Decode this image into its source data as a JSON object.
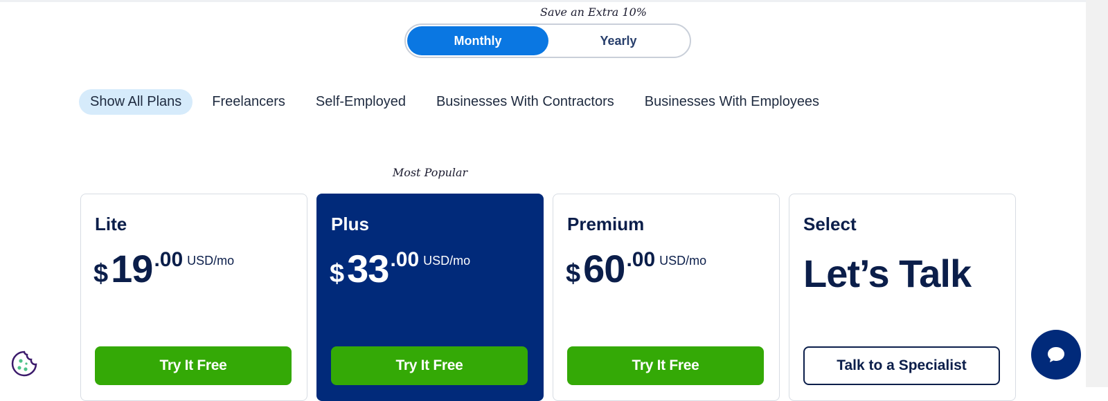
{
  "billing": {
    "save_note": "Save an Extra 10%",
    "options": [
      "Monthly",
      "Yearly"
    ],
    "selected": "Monthly"
  },
  "filters": {
    "items": [
      "Show All Plans",
      "Freelancers",
      "Self-Employed",
      "Businesses With Contractors",
      "Businesses With Employees"
    ],
    "active": "Show All Plans"
  },
  "badge": {
    "most_popular": "Most Popular"
  },
  "plans": [
    {
      "name": "Lite",
      "currency": "$",
      "whole": "19",
      "cents": ".00",
      "unit": "USD/mo",
      "cta": "Try It Free"
    },
    {
      "name": "Plus",
      "currency": "$",
      "whole": "33",
      "cents": ".00",
      "unit": "USD/mo",
      "cta": "Try It Free"
    },
    {
      "name": "Premium",
      "currency": "$",
      "whole": "60",
      "cents": ".00",
      "unit": "USD/mo",
      "cta": "Try It Free"
    },
    {
      "name": "Select",
      "headline": "Let’s Talk",
      "cta": "Talk to a Specialist"
    }
  ],
  "colors": {
    "primary_blue": "#0a77e2",
    "navy": "#012a7a",
    "green": "#34a906",
    "filter_active_bg": "#d6ebfb"
  },
  "icons": {
    "cookie": "cookie-icon",
    "chat": "chat-bubble-icon"
  }
}
